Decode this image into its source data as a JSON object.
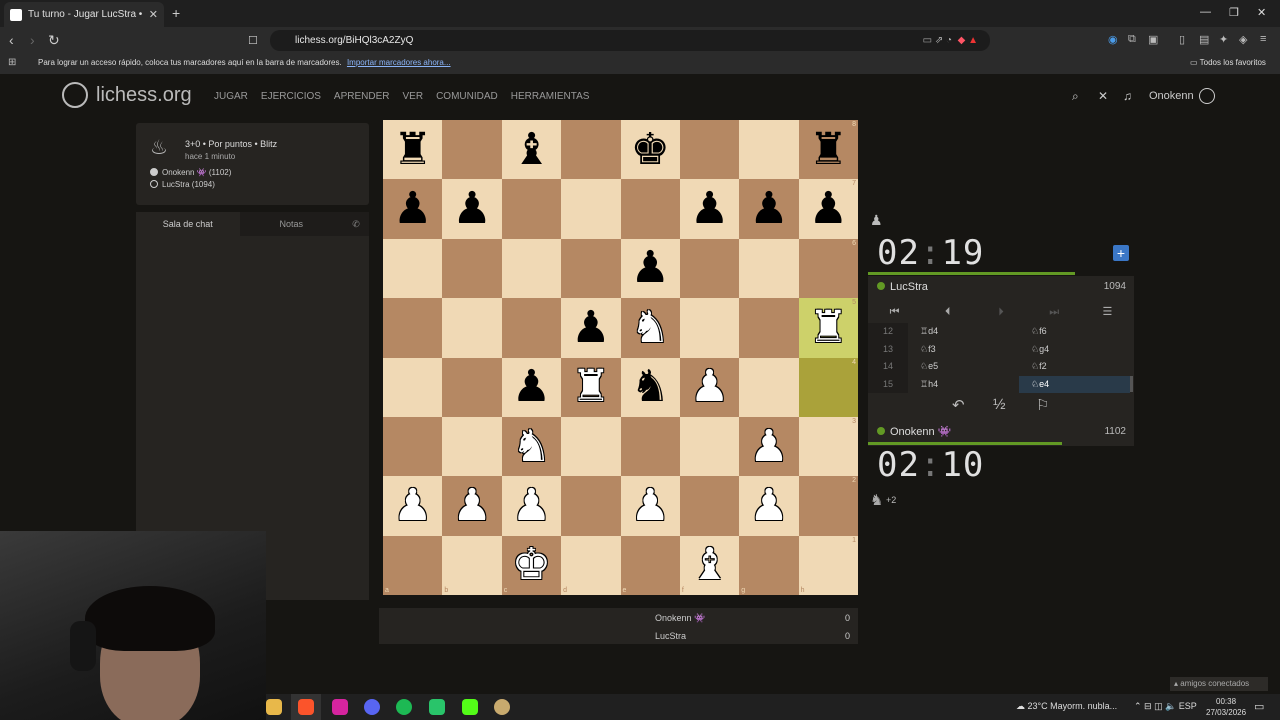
{
  "browser": {
    "tab_title": "Tu turno - Jugar LucStra • liches",
    "url": "lichess.org/BiHQl3cA2ZyQ",
    "bookmark_message": "Para lograr un acceso rápido, coloca tus marcadores aquí en la barra de marcadores.",
    "bookmark_import_link": "Importar marcadores ahora...",
    "all_favorites": "Todos los favoritos"
  },
  "site": {
    "logo_text": "lichess.org",
    "nav": [
      "JUGAR",
      "EJERCICIOS",
      "APRENDER",
      "VER",
      "COMUNIDAD",
      "HERRAMIENTAS"
    ],
    "username": "Onokenn"
  },
  "game_info": {
    "setup": "3+0 • Por puntos • Blitz",
    "ago": "hace 1 minuto",
    "white_player": "Onokenn 👾 (1102)",
    "black_player": "LucStra (1094)"
  },
  "chat": {
    "tab_chat": "Sala de chat",
    "tab_notes": "Notas"
  },
  "board": {
    "orientation": "white",
    "files": [
      "a",
      "b",
      "c",
      "d",
      "e",
      "f",
      "g",
      "h"
    ],
    "ranks": [
      "8",
      "7",
      "6",
      "5",
      "4",
      "3",
      "2",
      "1"
    ],
    "position": [
      [
        "bR",
        "",
        "bB",
        "",
        "bK",
        "",
        "",
        "bR"
      ],
      [
        "bP",
        "bP",
        "",
        "",
        "",
        "bP",
        "bP",
        "bP"
      ],
      [
        "",
        "",
        "",
        "",
        "bP",
        "",
        "",
        ""
      ],
      [
        "",
        "",
        "",
        "bP",
        "wN",
        "",
        "",
        "wR"
      ],
      [
        "",
        "",
        "bP",
        "wR",
        "bN",
        "wP",
        "",
        ""
      ],
      [
        "",
        "",
        "wN",
        "",
        "",
        "",
        "wP",
        ""
      ],
      [
        "wP",
        "wP",
        "wP",
        "",
        "wP",
        "",
        "wP",
        ""
      ],
      [
        "",
        "",
        "wK",
        "",
        "",
        "wB",
        "",
        ""
      ]
    ],
    "last_move": [
      "h4",
      "h5"
    ]
  },
  "clocks": {
    "opponent_min": "02",
    "opponent_sec": "19",
    "player_min": "02",
    "player_sec": "10",
    "opponent_time_fraction": 0.78,
    "player_time_fraction": 0.73
  },
  "players": {
    "opponent_name": "LucStra",
    "opponent_rating": "1094",
    "player_name": "Onokenn 👾",
    "player_rating": "1102"
  },
  "moves": [
    {
      "num": "12",
      "white": "♖d4",
      "black": "♘f6"
    },
    {
      "num": "13",
      "white": "♘f3",
      "black": "♘g4"
    },
    {
      "num": "14",
      "white": "♘e5",
      "black": "♘f2"
    },
    {
      "num": "15",
      "white": "♖h4",
      "black": "♘e4",
      "current": "black"
    }
  ],
  "material": "+2",
  "results": [
    {
      "name": "Onokenn 👾",
      "score": "0"
    },
    {
      "name": "LucStra",
      "score": "0"
    }
  ],
  "taskbar": {
    "weather": "23°C  Mayorm. nubla...",
    "lang": "ESP",
    "time": "00:38",
    "date": "27/03/2026",
    "friends": "amigos conectados"
  },
  "colors": {
    "light_square": "#f0d9b5",
    "dark_square": "#b58863",
    "highlight": "#aaa23a",
    "clock_bar": "#629924",
    "current_move": "#293a49"
  }
}
